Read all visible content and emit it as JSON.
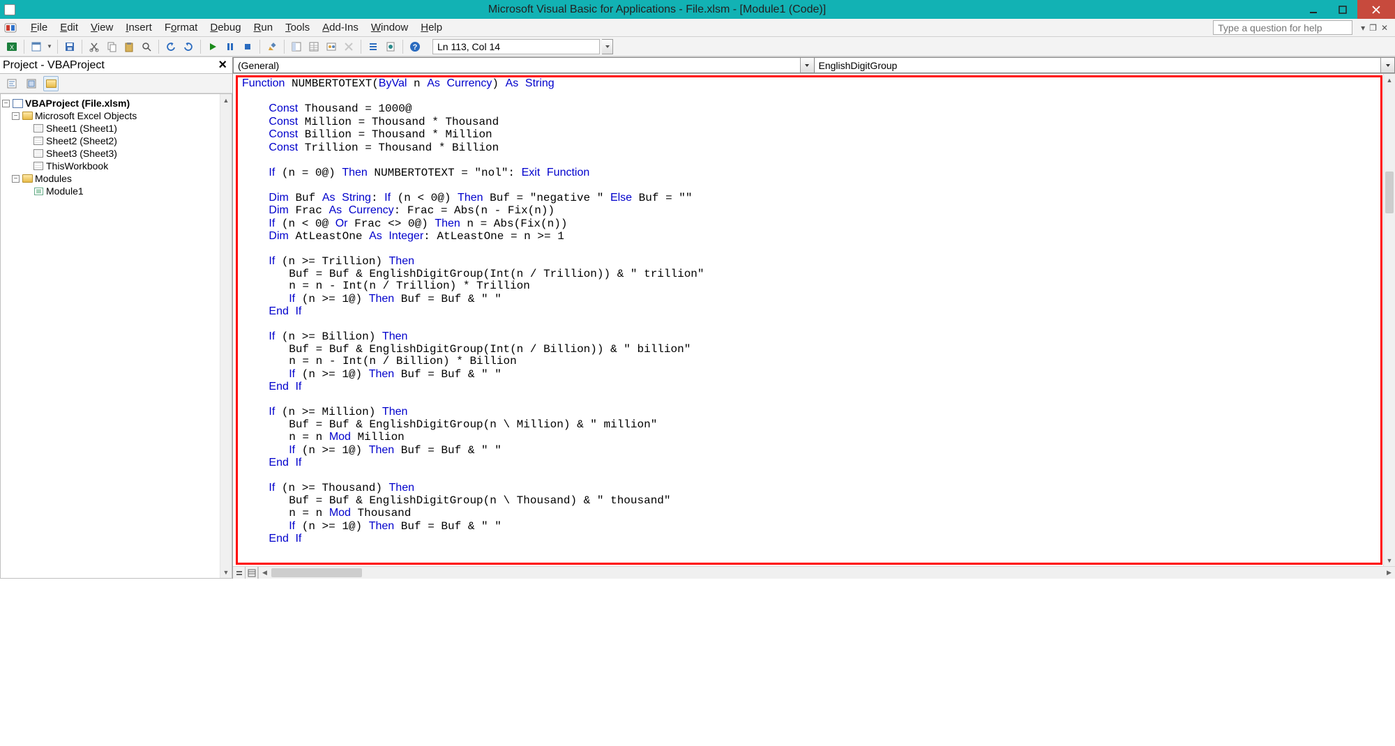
{
  "title": "Microsoft Visual Basic for Applications - File.xlsm - [Module1 (Code)]",
  "menu": {
    "file": "File",
    "edit": "Edit",
    "view": "View",
    "insert": "Insert",
    "format": "Format",
    "debug": "Debug",
    "run": "Run",
    "tools": "Tools",
    "addins": "Add-Ins",
    "window": "Window",
    "help": "Help"
  },
  "help_placeholder": "Type a question for help",
  "cursor_pos": "Ln 113, Col 14",
  "project_title": "Project - VBAProject",
  "tree": {
    "root": "VBAProject (File.xlsm)",
    "excel_objects": "Microsoft Excel Objects",
    "sheet1": "Sheet1 (Sheet1)",
    "sheet2": "Sheet2 (Sheet2)",
    "sheet3": "Sheet3 (Sheet3)",
    "thiswb": "ThisWorkbook",
    "modules": "Modules",
    "module1": "Module1"
  },
  "dd_left": "(General)",
  "dd_right": "EnglishDigitGroup",
  "code_plain": "Function NUMBERTOTEXT(ByVal n As Currency) As String\n\n    Const Thousand = 1000@\n    Const Million = Thousand * Thousand\n    Const Billion = Thousand * Million\n    Const Trillion = Thousand * Billion\n\n    If (n = 0@) Then NUMBERTOTEXT = \"nol\": Exit Function\n\n    Dim Buf As String: If (n < 0@) Then Buf = \"negative \" Else Buf = \"\"\n    Dim Frac As Currency: Frac = Abs(n - Fix(n))\n    If (n < 0@ Or Frac <> 0@) Then n = Abs(Fix(n))\n    Dim AtLeastOne As Integer: AtLeastOne = n >= 1\n\n    If (n >= Trillion) Then\n       Buf = Buf & EnglishDigitGroup(Int(n / Trillion)) & \" trillion\"\n       n = n - Int(n / Trillion) * Trillion\n       If (n >= 1@) Then Buf = Buf & \" \"\n    End If\n\n    If (n >= Billion) Then\n       Buf = Buf & EnglishDigitGroup(Int(n / Billion)) & \" billion\"\n       n = n - Int(n / Billion) * Billion\n       If (n >= 1@) Then Buf = Buf & \" \"\n    End If\n\n    If (n >= Million) Then\n       Buf = Buf & EnglishDigitGroup(n \\ Million) & \" million\"\n       n = n Mod Million\n       If (n >= 1@) Then Buf = Buf & \" \"\n    End If\n\n    If (n >= Thousand) Then\n       Buf = Buf & EnglishDigitGroup(n \\ Thousand) & \" thousand\"\n       n = n Mod Thousand\n       If (n >= 1@) Then Buf = Buf & \" \"\n    End If\n"
}
